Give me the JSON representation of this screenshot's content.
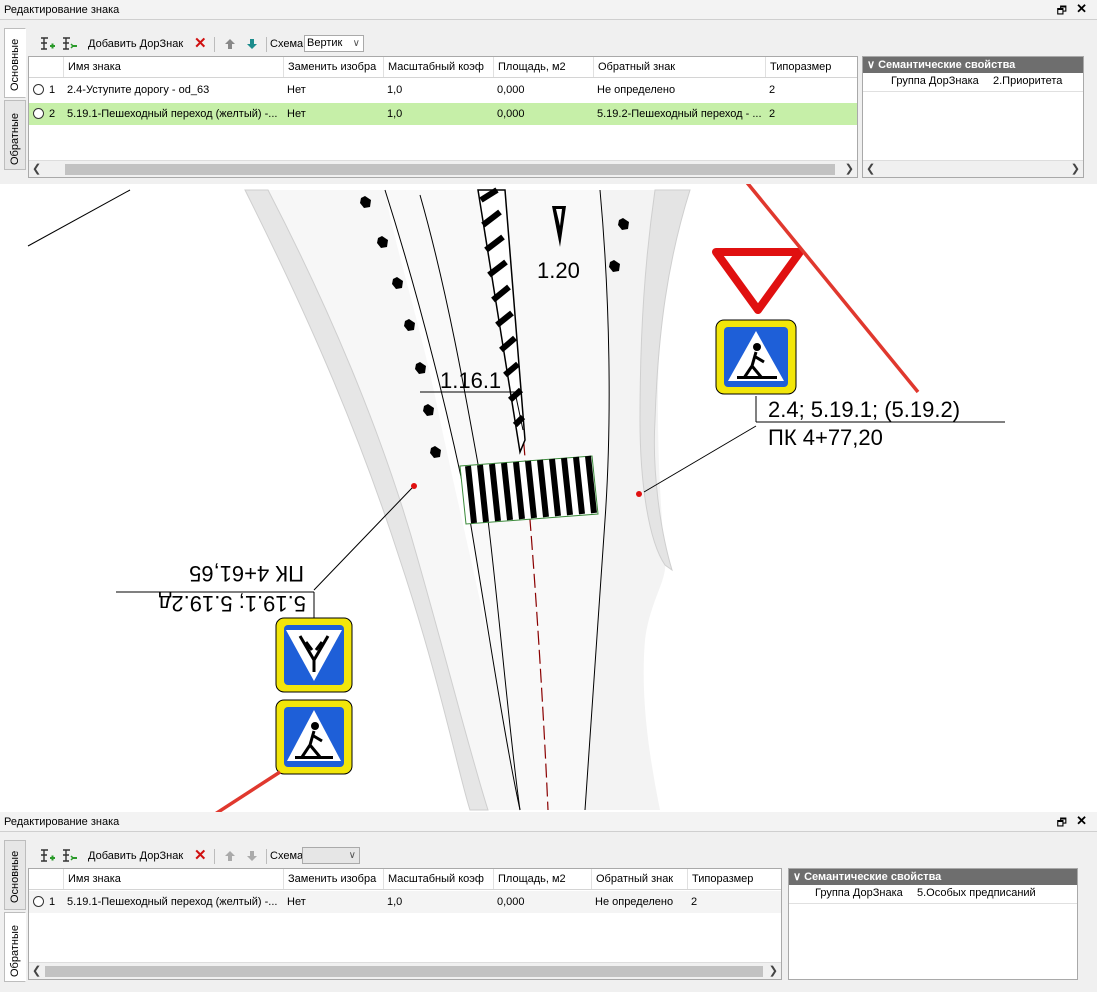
{
  "top_panel": {
    "title": "Редактирование знака",
    "restore_icon": "restore-icon",
    "close_glyph": "✕",
    "tabs": [
      "Основные",
      "Обратные"
    ],
    "toolbar": {
      "add_label": "Добавить ДорЗнак",
      "scheme_label": "Схема",
      "scheme_value": "Вертик",
      "delete_glyph": "✕"
    },
    "columns": [
      "Имя знака",
      "Заменить изобра",
      "Масштабный коэф",
      "Площадь, м2",
      "Обратный знак",
      "Типоразмер"
    ],
    "rows": [
      {
        "num": "1",
        "name": "2.4-Уступите дорогу - od_63",
        "replace": "Нет",
        "scale": "1,0",
        "area": "0,000",
        "reverse": "Не определено",
        "size": "2"
      },
      {
        "num": "2",
        "name": "5.19.1-Пешеходный переход (желтый) -...",
        "replace": "Нет",
        "scale": "1,0",
        "area": "0,000",
        "reverse": "5.19.2-Пешеходный переход - ...",
        "size": "2"
      }
    ],
    "semantic": {
      "header": "Семантические свойства",
      "key": "Группа ДорЗнака",
      "value": "2.Приоритета"
    }
  },
  "bottom_panel": {
    "title": "Редактирование знака",
    "tabs": [
      "Основные",
      "Обратные"
    ],
    "toolbar": {
      "add_label": "Добавить ДорЗнак",
      "scheme_label": "Схема",
      "scheme_value": ""
    },
    "columns": [
      "Имя знака",
      "Заменить изобра",
      "Масштабный коэф",
      "Площадь, м2",
      "Обратный знак",
      "Типоразмер"
    ],
    "rows": [
      {
        "num": "1",
        "name": "5.19.1-Пешеходный переход (желтый) -...",
        "replace": "Нет",
        "scale": "1,0",
        "area": "0,000",
        "reverse": "Не определено",
        "size": "2"
      }
    ],
    "semantic": {
      "header": "Семантические свойства",
      "key": "Группа ДорЗнака",
      "value": "5.Особых предписаний"
    }
  },
  "map": {
    "label_1_20": "1.20",
    "label_1_16_1": "1.16.1",
    "right_sign_codes": "2.4; 5.19.1; (5.19.2)",
    "right_sign_pk": "ПК 4+77,20",
    "left_sign_codes": "5.19.1; 5.19.2д",
    "left_sign_pk": "ПК 4+61,65"
  },
  "colors": {
    "selected_row": "#c6efa8",
    "arrow": "#e0382e",
    "sign_blue": "#1e5fd8",
    "sign_yellow": "#f2e60a"
  }
}
